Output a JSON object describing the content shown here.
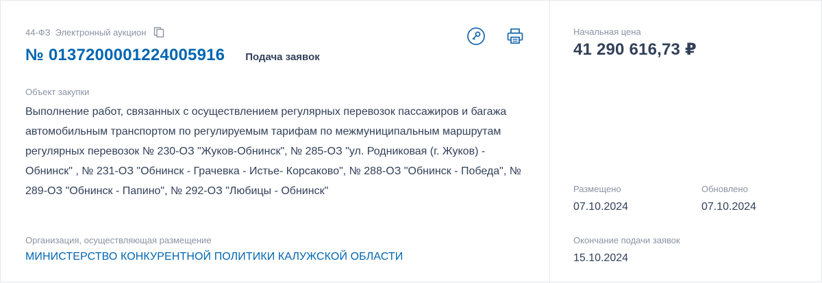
{
  "header": {
    "law": "44-ФЗ",
    "procedure_type": "Электронный аукцион",
    "number": "№ 0137200001224005916",
    "status": "Подача заявок"
  },
  "icons": {
    "copy": "copy-icon",
    "key": "key-icon",
    "print": "print-icon"
  },
  "object": {
    "label": "Объект закупки",
    "text": "Выполнение работ, связанных с осуществлением регулярных перевозок пассажиров и багажа автомобильным транспортом по регулируемым тарифам по межмуниципальным маршрутам регулярных перевозок № 230-ОЗ \"Жуков-Обнинск\", № 285-ОЗ \"ул. Родниковая (г. Жуков) - Обнинск\" , № 231-ОЗ \"Обнинск - Грачевка - Истье- Корсаково\", № 288-ОЗ \"Обнинск - Победа\", № 289-ОЗ \"Обнинск - Папино\", № 292-ОЗ \"Любицы - Обнинск\""
  },
  "organization": {
    "label": "Организация, осуществляющая размещение",
    "name": "МИНИСТЕРСТВО КОНКУРЕНТНОЙ ПОЛИТИКИ КАЛУЖСКОЙ ОБЛАСТИ"
  },
  "price": {
    "label": "Начальная цена",
    "value": "41 290 616,73 ₽"
  },
  "dates": {
    "posted_label": "Размещено",
    "posted_value": "07.10.2024",
    "updated_label": "Обновлено",
    "updated_value": "07.10.2024",
    "deadline_label": "Окончание подачи заявок",
    "deadline_value": "15.10.2024"
  },
  "colors": {
    "accent": "#0065b1",
    "text": "#334059",
    "muted": "#8a93a3"
  }
}
